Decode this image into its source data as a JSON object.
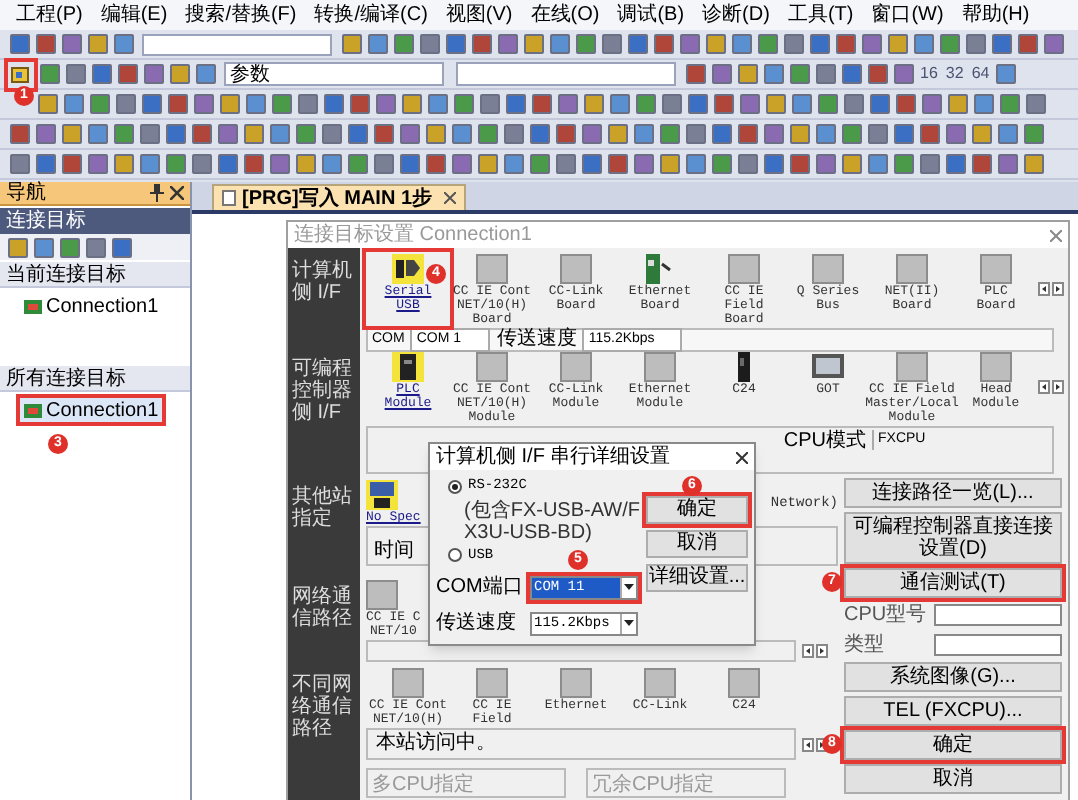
{
  "menu": [
    "工程(P)",
    "编辑(E)",
    "搜索/替换(F)",
    "转换/编译(C)",
    "视图(V)",
    "在线(O)",
    "调试(B)",
    "诊断(D)",
    "工具(T)",
    "窗口(W)",
    "帮助(H)"
  ],
  "toolbar": {
    "highlighted_step": "1",
    "combo": "参数",
    "scale_labels": [
      "16",
      "32",
      "64"
    ]
  },
  "navigation": {
    "title": "导航",
    "section": "连接目标",
    "groups": [
      {
        "label": "当前连接目标",
        "items": [
          {
            "label": "Connection1",
            "selected": false
          }
        ]
      },
      {
        "label": "所有连接目标",
        "items": [
          {
            "label": "Connection1",
            "selected": true,
            "step": "3"
          }
        ]
      }
    ]
  },
  "editor_tab": {
    "label": "[PRG]写入 MAIN 1步"
  },
  "dialog": {
    "title": "连接目标设置 Connection1",
    "computer_if": {
      "label": "计算机侧 I/F",
      "modules": [
        {
          "label": "Serial\nUSB",
          "kind": "serial",
          "selected": true,
          "step": "4"
        },
        {
          "label": "CC IE Cont\nNET/10(H)\nBoard",
          "kind": "gray",
          "selected": false
        },
        {
          "label": "CC-Link\nBoard",
          "kind": "gray",
          "selected": false
        },
        {
          "label": "Ethernet\nBoard",
          "kind": "ethernet",
          "selected": false
        },
        {
          "label": "CC IE Field\nBoard",
          "kind": "gray",
          "selected": false
        },
        {
          "label": "Q Series\nBus",
          "kind": "gray",
          "selected": false
        },
        {
          "label": "NET(II)\nBoard",
          "kind": "gray",
          "selected": false
        },
        {
          "label": "PLC\nBoard",
          "kind": "gray",
          "selected": false
        }
      ],
      "com_label": "COM",
      "com_value": "COM 1",
      "speed_label": "传送速度",
      "speed_value": "115.2Kbps"
    },
    "plc_if": {
      "label": "可编程控制器侧 I/F",
      "modules": [
        {
          "label": "PLC\nModule",
          "kind": "plc",
          "selected": true
        },
        {
          "label": "CC IE Cont\nNET/10(H)\nModule",
          "kind": "gray",
          "selected": false
        },
        {
          "label": "CC-Link\nModule",
          "kind": "gray",
          "selected": false
        },
        {
          "label": "Ethernet\nModule",
          "kind": "gray",
          "selected": false
        },
        {
          "label": "C24",
          "kind": "c24",
          "selected": false
        },
        {
          "label": "GOT",
          "kind": "got",
          "selected": false
        },
        {
          "label": "CC IE Field\nMaster/Local\nModule",
          "kind": "gray",
          "selected": false
        },
        {
          "label": "Head Module",
          "kind": "gray",
          "selected": false
        }
      ],
      "cpu_mode_label": "CPU模式",
      "cpu_mode_value": "FXCPU"
    },
    "other_station": {
      "label": "其他站指定",
      "modules": [
        {
          "label": "No Spec",
          "kind": "other",
          "selected": true
        }
      ],
      "note": "Network)",
      "box_text": "时间"
    },
    "network_route": {
      "label": "网络通信路径",
      "modules": [
        {
          "label": "CC IE C\nNET/10",
          "kind": "gray",
          "selected": false
        }
      ]
    },
    "different_network": {
      "label": "不同网络通信路径",
      "modules": [
        {
          "label": "CC IE Cont\nNET/10(H)",
          "kind": "gray",
          "selected": false
        },
        {
          "label": "CC IE\nField",
          "kind": "gray",
          "selected": false
        },
        {
          "label": "Ethernet",
          "kind": "gray",
          "selected": false
        },
        {
          "label": "CC-Link",
          "kind": "gray",
          "selected": false
        },
        {
          "label": "C24",
          "kind": "gray",
          "selected": false
        }
      ],
      "status": "本站访问中。",
      "groups": [
        "多CPU指定",
        "冗余CPU指定"
      ]
    },
    "side_controls": [
      {
        "kind": "button",
        "label": "连接路径一览(L)..."
      },
      {
        "kind": "button",
        "label": "可编程控制器直接连接设置(D)"
      },
      {
        "kind": "button",
        "label": "通信测试(T)",
        "step": "7"
      },
      {
        "kind": "field",
        "label": "CPU型号"
      },
      {
        "kind": "field",
        "label": "类型"
      },
      {
        "kind": "button",
        "label": "系统图像(G)..."
      },
      {
        "kind": "button",
        "label": "TEL (FXCPU)..."
      },
      {
        "kind": "button",
        "label": "确定",
        "step": "8"
      },
      {
        "kind": "button",
        "label": "取消"
      }
    ]
  },
  "serial_dialog": {
    "title": "计算机侧 I/F 串行详细设置",
    "radios": [
      {
        "label": "RS-232C",
        "sublabel": "(包含FX-USB-AW/FX3U-USB-BD)",
        "selected": true
      },
      {
        "label": "USB",
        "selected": false
      }
    ],
    "com_port": {
      "label": "COM端口",
      "value": "COM 11",
      "step": "5"
    },
    "speed": {
      "label": "传送速度",
      "value": "115.2Kbps"
    },
    "buttons": [
      {
        "label": "确定",
        "step": "6"
      },
      {
        "label": "取消"
      },
      {
        "label": "详细设置..."
      }
    ]
  }
}
